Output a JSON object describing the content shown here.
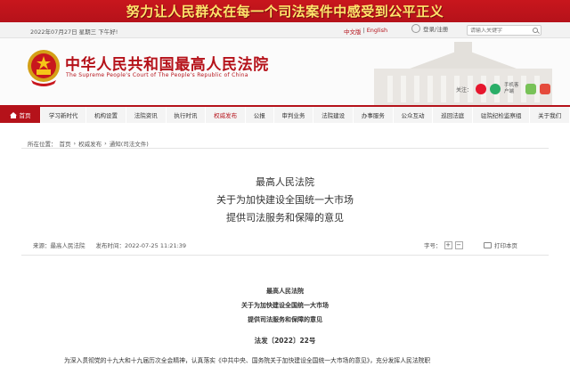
{
  "banner": {
    "slogan": "努力让人民群众在每一个司法案件中感受到公平正义"
  },
  "utility": {
    "date": "2022年07月27日   星期三    下午好!",
    "lang_cn": "中文版",
    "lang_sep": "|",
    "lang_en": "English",
    "login": "登录/注册",
    "search_placeholder": "请输入关键字"
  },
  "header": {
    "title": "中华人民共和国最高人民法院",
    "subtitle": "The Supreme People's Court of The People's Republic of China",
    "follow_label": "关注：",
    "client_label": "手机客户端"
  },
  "nav": {
    "home": "首页",
    "items": [
      "学习新时代",
      "机构设置",
      "法院资讯",
      "执行时讯",
      "权威发布",
      "公报",
      "审判业务",
      "法院建设",
      "办事服务",
      "公众互动",
      "巡回法庭",
      "驻院纪检监察组",
      "关于我们"
    ],
    "active_index": 4
  },
  "breadcrumb": {
    "label": "所在位置：",
    "items": [
      "首页",
      "权威发布",
      "通知(司法文件)"
    ],
    "sep": "›"
  },
  "article": {
    "title_lines": [
      "最高人民法院",
      "关于为加快建设全国统一大市场",
      "提供司法服务和保障的意见"
    ],
    "source_label": "来源：",
    "source": "最高人民法院",
    "time_label": "发布时间：",
    "time": "2022-07-25 11:21:39",
    "fontsize_label": "字号：",
    "fontsize_plus": "+",
    "fontsize_minus": "−",
    "print_label": "打印本页",
    "doc_lines": [
      "最高人民法院",
      "关于为加快建设全国统一大市场",
      "提供司法服务和保障的意见"
    ],
    "doc_number": "法发〔2022〕22号",
    "body_start": "为深入贯彻党的十九大和十九届历次全会精神，认真落实《中共中央、国务院关于加快建设全国统一大市场的意见》，充分发挥人民法院职"
  },
  "colors": {
    "brand_red": "#b5121a",
    "slogan_yellow": "#ffe46b"
  }
}
